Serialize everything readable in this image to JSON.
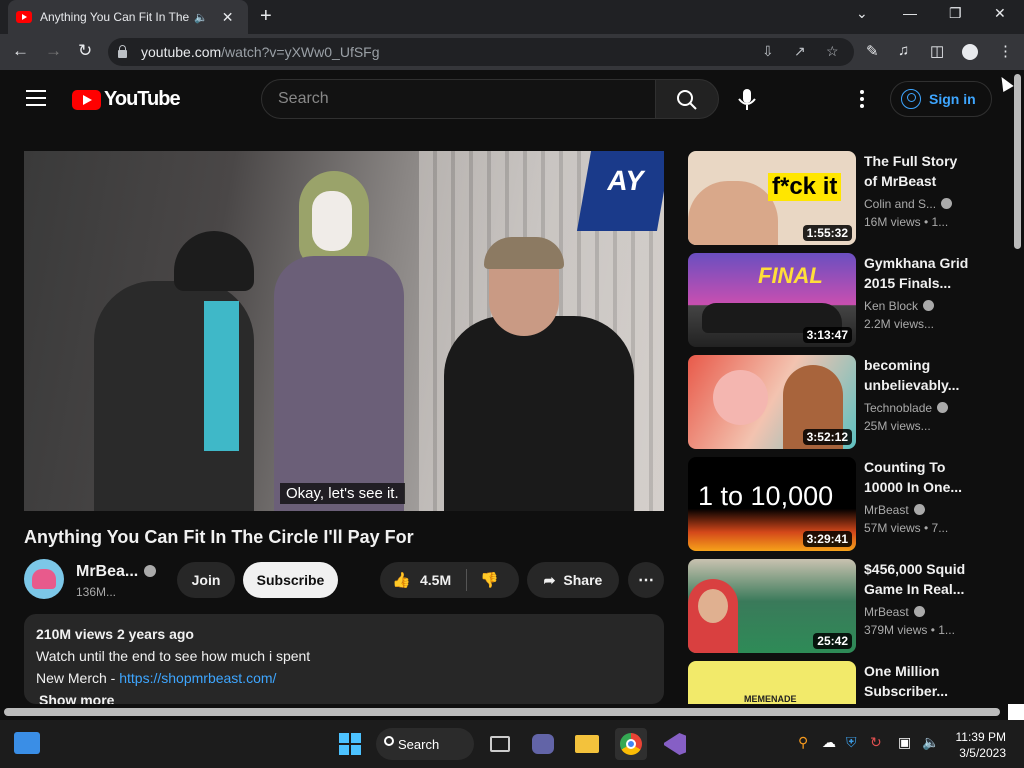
{
  "browser": {
    "tab_title": "Anything You Can Fit In The Circle I'll Pay For - YouTube",
    "url_host": "youtube.com",
    "url_path": "/watch?v=yXWw0_UfSFg"
  },
  "yt": {
    "logo": "YouTube",
    "search_placeholder": "Search",
    "signin": "Sign in"
  },
  "video": {
    "caption": "Okay, let's see it.",
    "title": "Anything You Can Fit In The Circle I'll Pay For",
    "channel": "MrBea...",
    "subscribers": "136M...",
    "join": "Join",
    "subscribe": "Subscribe",
    "likes": "4.5M",
    "share": "Share"
  },
  "description": {
    "stats": "210M views  2 years ago",
    "line1": "Watch until the end to see how much i spent",
    "merch_label": "New Merch - ",
    "merch_link": "https://shopmrbeast.com/",
    "show_more": "Show more"
  },
  "recommendations": [
    {
      "title": "The Full Story of MrBeast",
      "channel": "Colin and S...",
      "meta": "16M views  • 1...",
      "duration": "1:55:32",
      "thumb_text": "f*ck it",
      "color": "#e9d7c4"
    },
    {
      "title": "Gymkhana Grid 2015 Finals...",
      "channel": "Ken Block",
      "meta": "2.2M views...",
      "duration": "3:13:47",
      "thumb_text": "FINAL",
      "color": "#6a4fc0"
    },
    {
      "title": "becoming unbelievably...",
      "channel": "Technoblade",
      "meta": "25M views...",
      "duration": "3:52:12",
      "thumb_text": "",
      "color": "#e85a4a"
    },
    {
      "title": "Counting To 10000 In One...",
      "channel": "MrBeast",
      "meta": "57M views  • 7...",
      "duration": "3:29:41",
      "thumb_text": "1 to 10,000",
      "color": "#111111"
    },
    {
      "title": "$456,000 Squid Game In Real...",
      "channel": "MrBeast",
      "meta": "379M views  • 1...",
      "duration": "25:42",
      "thumb_text": "",
      "color": "#2e8b57"
    },
    {
      "title": "One Million Subscriber...",
      "channel": "",
      "meta": "",
      "duration": "",
      "thumb_text": "MEMENADE",
      "color": "#f2ea6a"
    }
  ],
  "taskbar": {
    "search": "Search",
    "time": "11:39 PM",
    "date": "3/5/2023"
  }
}
